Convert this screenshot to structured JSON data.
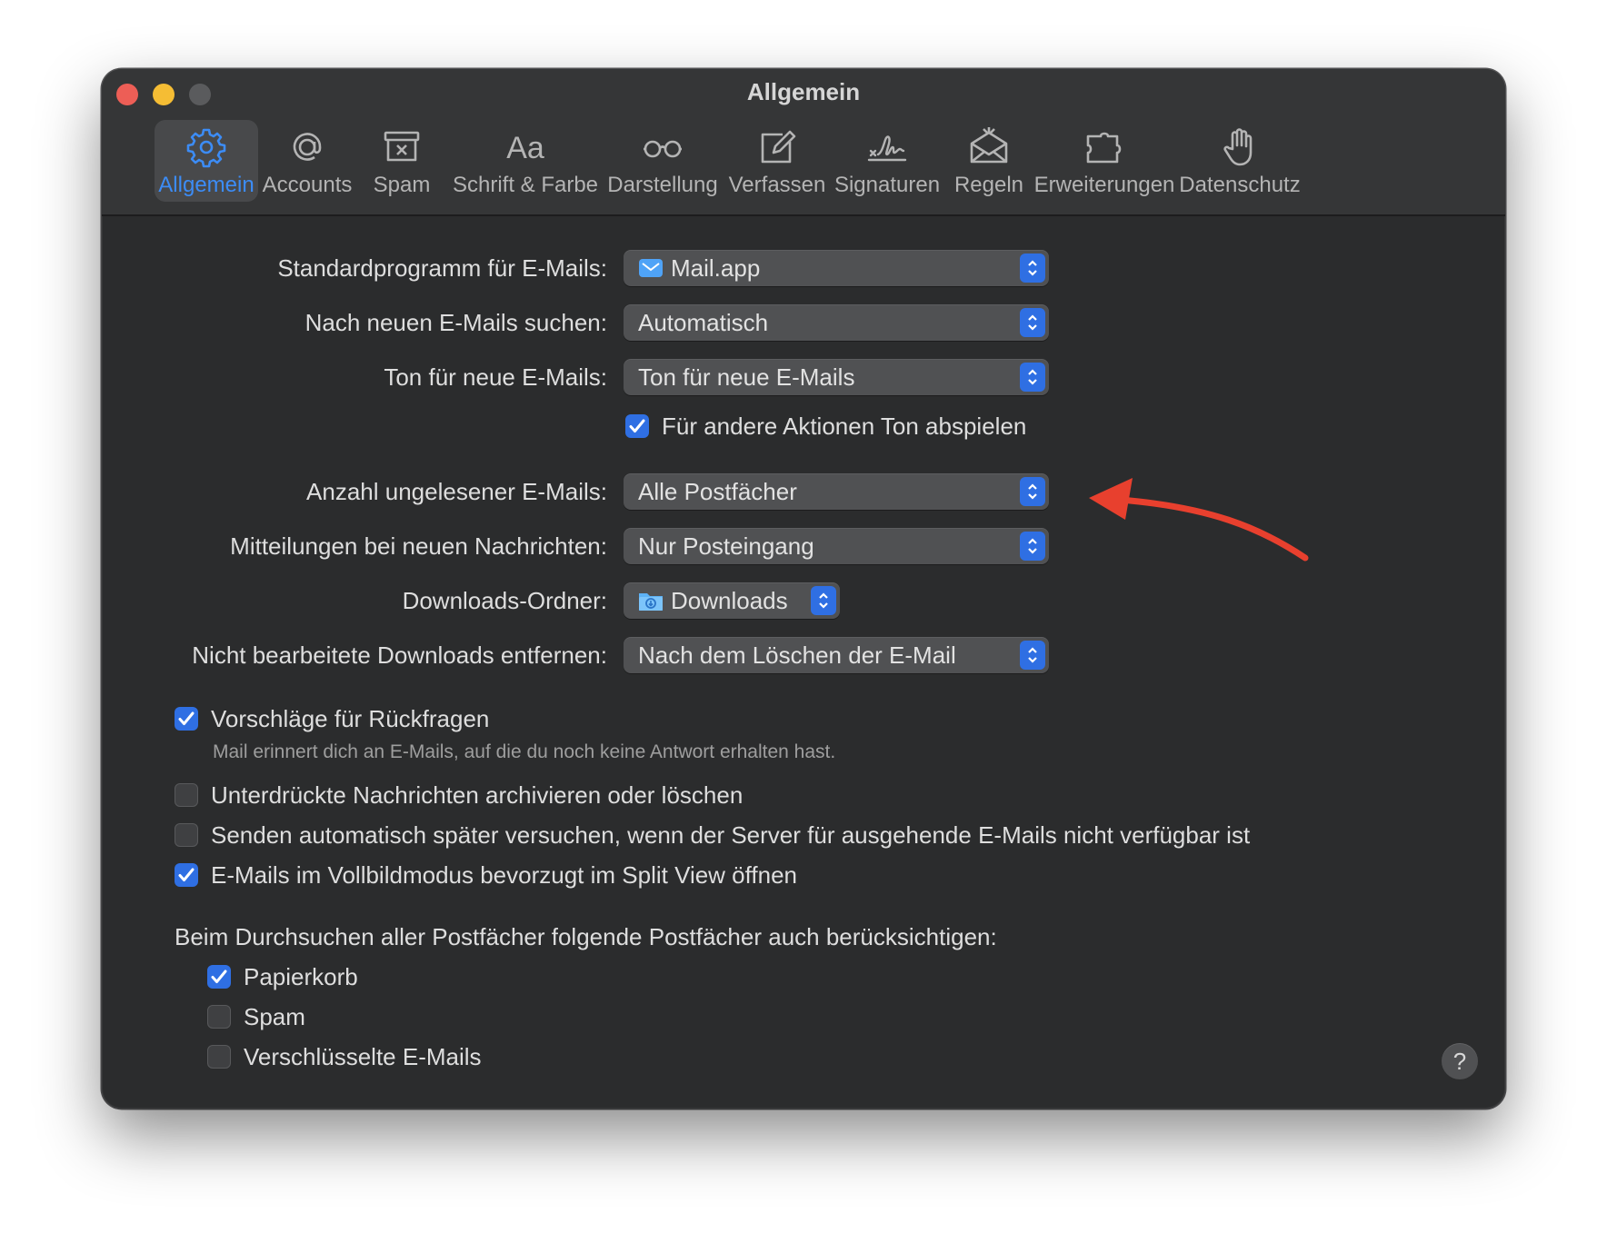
{
  "window": {
    "title": "Allgemein"
  },
  "toolbar": {
    "items": [
      {
        "label": "Allgemein",
        "icon": "gear-icon"
      },
      {
        "label": "Accounts",
        "icon": "at-icon"
      },
      {
        "label": "Spam",
        "icon": "junk-box-icon"
      },
      {
        "label": "Schrift & Farbe",
        "icon": "font-icon"
      },
      {
        "label": "Darstellung",
        "icon": "glasses-icon"
      },
      {
        "label": "Verfassen",
        "icon": "compose-icon"
      },
      {
        "label": "Signaturen",
        "icon": "signature-icon"
      },
      {
        "label": "Regeln",
        "icon": "rules-envelope-icon"
      },
      {
        "label": "Erweiterungen",
        "icon": "puzzle-icon"
      },
      {
        "label": "Datenschutz",
        "icon": "hand-icon"
      }
    ]
  },
  "settings": {
    "default_mail": {
      "label": "Standardprogramm für E-Mails:",
      "value": "Mail.app"
    },
    "check_mail": {
      "label": "Nach neuen E-Mails suchen:",
      "value": "Automatisch"
    },
    "new_mail_sound": {
      "label": "Ton für neue E-Mails:",
      "value": "Ton für neue E-Mails"
    },
    "other_sounds": {
      "label": "Für andere Aktionen Ton abspielen",
      "checked": true
    },
    "unread_count": {
      "label": "Anzahl ungelesener E-Mails:",
      "value": "Alle Postfächer"
    },
    "notifications": {
      "label": "Mitteilungen bei neuen Nachrichten:",
      "value": "Nur Posteingang"
    },
    "downloads_folder": {
      "label": "Downloads-Ordner:",
      "value": "Downloads"
    },
    "remove_downloads": {
      "label": "Nicht bearbeitete Downloads entfernen:",
      "value": "Nach dem Löschen der E-Mail"
    }
  },
  "options": {
    "follow_up": {
      "label": "Vorschläge für Rückfragen",
      "checked": true,
      "hint": "Mail erinnert dich an E-Mails, auf die du noch keine Antwort erhalten hast."
    },
    "muted_archive": {
      "label": "Unterdrückte Nachrichten archivieren oder löschen",
      "checked": false
    },
    "retry_send": {
      "label": "Senden automatisch später versuchen, wenn der Server für ausgehende E-Mails nicht verfügbar ist",
      "checked": false
    },
    "split_view": {
      "label": "E-Mails im Vollbildmodus bevorzugt im Split View öffnen",
      "checked": true
    }
  },
  "search": {
    "heading": "Beim Durchsuchen aller Postfächer folgende Postfächer auch berücksichtigen:",
    "trash": {
      "label": "Papierkorb",
      "checked": true
    },
    "junk": {
      "label": "Spam",
      "checked": false
    },
    "encrypted": {
      "label": "Verschlüsselte E-Mails",
      "checked": false
    }
  },
  "help": {
    "label": "?"
  },
  "colors": {
    "accent": "#2f6fe3",
    "active_tab_text": "#3c8cf6",
    "annotation_arrow": "#e8402e"
  }
}
